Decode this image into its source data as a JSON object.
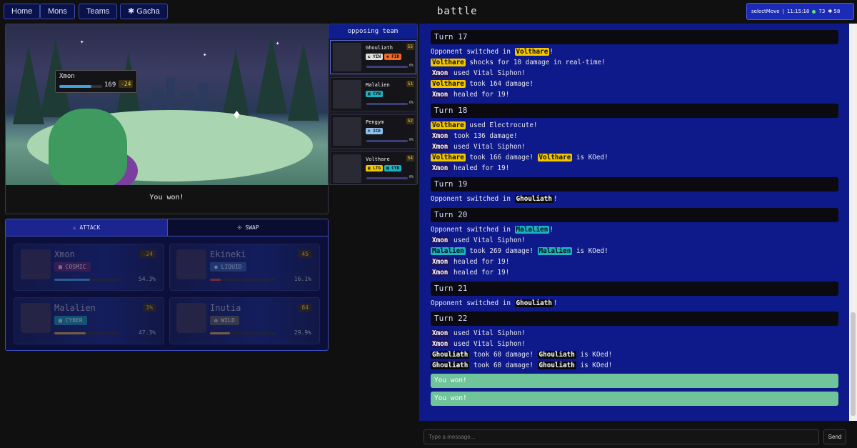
{
  "nav": {
    "home": "Home",
    "mons": "Mons",
    "teams": "Teams",
    "gacha": "✱ Gacha"
  },
  "page_title": "battle",
  "status": {
    "state": "selectMove",
    "time": "11:15:18",
    "online": "73",
    "currency": "✱ 58"
  },
  "scene": {
    "player_name": "Xmon",
    "player_hp": "169",
    "player_hp_fraction": 0.75,
    "player_delta": "-24",
    "result": "You won!"
  },
  "opposing": {
    "header": "opposing team",
    "mons": [
      {
        "name": "Ghouliath",
        "level": "55",
        "types": [
          {
            "label": "☯ YIN",
            "color": "#e0e0e0"
          },
          {
            "label": "✱ FIR",
            "color": "#f06a2a"
          }
        ],
        "pct": "0%"
      },
      {
        "name": "Malalien",
        "level": "51",
        "types": [
          {
            "label": "▦ CYB",
            "color": "#1ab3c6"
          }
        ],
        "pct": "0%"
      },
      {
        "name": "Pengym",
        "level": "52",
        "types": [
          {
            "label": "❄ ICE",
            "color": "#8fc0f0"
          }
        ],
        "pct": "0%"
      },
      {
        "name": "Volthare",
        "level": "54",
        "types": [
          {
            "label": "▣ LTG",
            "color": "#f2c700"
          },
          {
            "label": "▦ CYB",
            "color": "#1ab3c6"
          }
        ],
        "pct": "0%"
      }
    ]
  },
  "controls": {
    "attack_tab": "⚔ ATTACK",
    "swap_tab": "⟐ SWAP",
    "mons": [
      {
        "name": "Xmon",
        "level": "-24",
        "type": "▦ COSMIC",
        "type_color": "#5a2a6a",
        "pct": "54.3%",
        "fill": 0.543,
        "bar_color": "#3fa0e0"
      },
      {
        "name": "Ekineki",
        "level": "45",
        "type": "◉ LIQUID",
        "type_color": "#2f5aa0",
        "pct": "16.1%",
        "fill": 0.161,
        "bar_color": "#d04040"
      },
      {
        "name": "Malalien",
        "level": "1%",
        "type": "▦ CYBER",
        "type_color": "#1a8aa0",
        "pct": "47.3%",
        "fill": 0.473,
        "bar_color": "#c9a040"
      },
      {
        "name": "Inutia",
        "level": "84",
        "type": "✿ WILD",
        "type_color": "#5a5a5a",
        "pct": "29.9%",
        "fill": 0.299,
        "bar_color": "#c9a040"
      }
    ]
  },
  "log": {
    "turn17": "Turn 17",
    "l1a": "Opponent switched in ",
    "l1b": "Volthare",
    "l1c": "!",
    "l2a": "Volthare",
    "l2b": " shocks for 10 damage in real-time!",
    "l3a": "Xmon",
    "l3b": " used Vital Siphon!",
    "l4a": "Volthare",
    "l4b": " took 164 damage!",
    "l5a": "Xmon",
    "l5b": " healed for 19!",
    "turn18": "Turn 18",
    "l6a": "Volthare",
    "l6b": " used Electrocute!",
    "l7a": "Xmon",
    "l7b": " took 136 damage!",
    "l8a": "Xmon",
    "l8b": " used Vital Siphon!",
    "l9a": "Volthare",
    "l9b": " took 166 damage! ",
    "l9c": "Volthare",
    "l9d": " is KOed!",
    "l10a": "Xmon",
    "l10b": " healed for 19!",
    "turn19": "Turn 19",
    "l11a": "Opponent switched in ",
    "l11b": "Ghouliath",
    "l11c": "!",
    "turn20": "Turn 20",
    "l12a": "Opponent switched in ",
    "l12b": "Malalien",
    "l12c": "!",
    "l13a": "Xmon",
    "l13b": " used Vital Siphon!",
    "l14a": "Malalien",
    "l14b": " took 269 damage! ",
    "l14c": "Malalien",
    "l14d": " is KOed!",
    "l15a": "Xmon",
    "l15b": " healed for 19!",
    "l16a": "Xmon",
    "l16b": " healed for 19!",
    "turn21": "Turn 21",
    "l17a": "Opponent switched in ",
    "l17b": "Ghouliath",
    "l17c": "!",
    "turn22": "Turn 22",
    "l18a": "Xmon",
    "l18b": " used Vital Siphon!",
    "l19a": "Xmon",
    "l19b": " used Vital Siphon!",
    "l20a": "Ghouliath",
    "l20b": " took 60 damage! ",
    "l20c": "Ghouliath",
    "l20d": " is KOed!",
    "l21a": "Ghouliath",
    "l21b": " took 60 damage! ",
    "l21c": "Ghouliath",
    "l21d": " is KOed!",
    "win1": "You won!",
    "win2": "You won!"
  },
  "chat": {
    "placeholder": "Type a message...",
    "send": "Send"
  }
}
